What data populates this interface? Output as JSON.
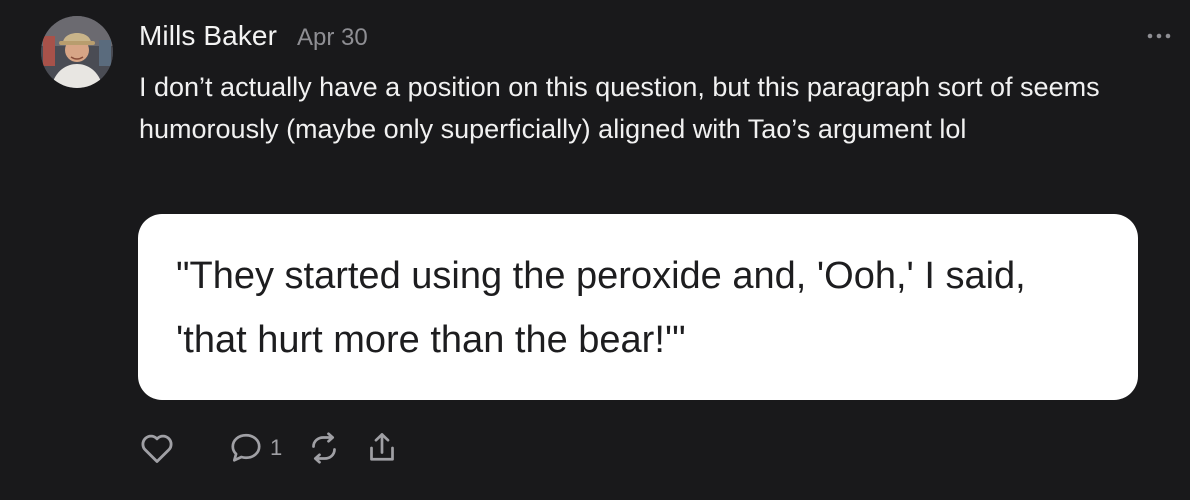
{
  "post": {
    "author": "Mills Baker",
    "date": "Apr 30",
    "body": "I don’t actually have a position on this question, but this paragraph sort of seems humorously (maybe only superficially) aligned with Tao’s argument lol",
    "quote": "\"They started using the peroxide and, 'Ooh,' I said, 'that hurt more than the bear!'\""
  },
  "actions": {
    "like_icon": "heart-icon",
    "comment_icon": "comment-bubble-icon",
    "comment_count": "1",
    "restack_icon": "restack-icon",
    "share_icon": "share-icon"
  },
  "menu": {
    "icon": "more-options-icon"
  },
  "colors": {
    "background": "#19191b",
    "text_primary": "#f1f1f1",
    "text_secondary": "#8e8e93",
    "icon": "#a0a0a5",
    "card_background": "#ffffff",
    "card_text": "#1d1d1f"
  }
}
